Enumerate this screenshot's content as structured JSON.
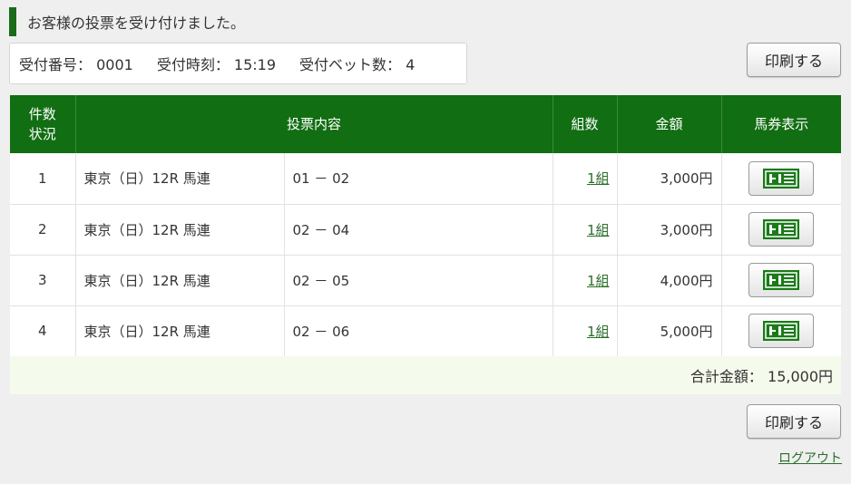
{
  "notice": "お客様の投票を受け付けました。",
  "info": {
    "receipt_no": "受付番号： 0001",
    "receipt_time": "受付時刻： 15:19",
    "bet_count": "受付ベット数： 4"
  },
  "print_label": "印刷する",
  "table": {
    "headers": {
      "no_line1": "件数",
      "no_line2": "状況",
      "content": "投票内容",
      "kumi": "組数",
      "amount": "金額",
      "ticket": "馬券表示"
    },
    "rows": [
      {
        "no": "1",
        "race": "東京（日）12R 馬連",
        "combo": "01 － 02",
        "kumi": "1組",
        "amount": "3,000円"
      },
      {
        "no": "2",
        "race": "東京（日）12R 馬連",
        "combo": "02 － 04",
        "kumi": "1組",
        "amount": "3,000円"
      },
      {
        "no": "3",
        "race": "東京（日）12R 馬連",
        "combo": "02 － 05",
        "kumi": "1組",
        "amount": "4,000円"
      },
      {
        "no": "4",
        "race": "東京（日）12R 馬連",
        "combo": "02 － 06",
        "kumi": "1組",
        "amount": "5,000円"
      }
    ]
  },
  "total": "合計金額： 15,000円",
  "logout": "ログアウト",
  "colors": {
    "accent": "#116e12",
    "total_bg": "#f5fbec"
  },
  "icons": {
    "ticket": "ticket-icon"
  }
}
